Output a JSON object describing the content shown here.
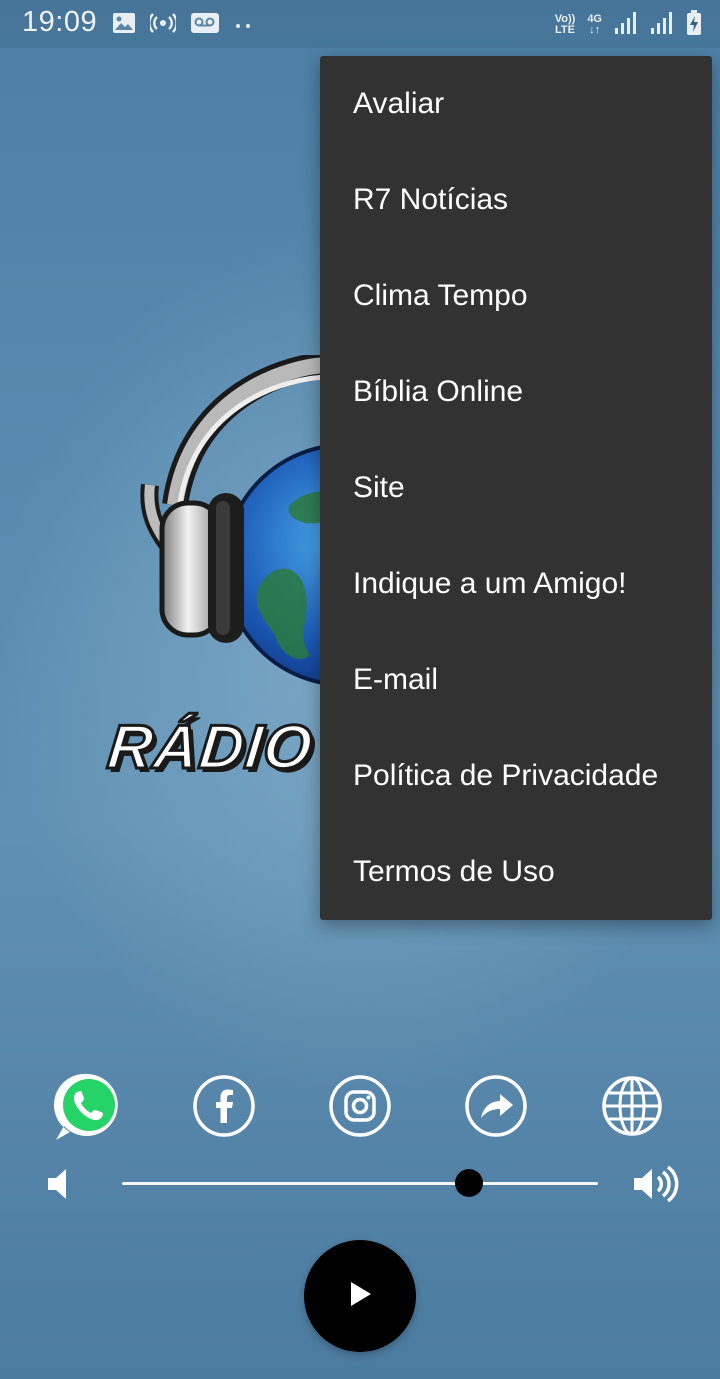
{
  "status_bar": {
    "time": "19:09",
    "volte_line1": "Vo))",
    "volte_line2": "LTE",
    "net_line1": "4G",
    "net_line2": "↓↑",
    "icons": [
      "image-icon",
      "hotspot-icon",
      "voicemail-icon",
      "dots-icon",
      "volte-icon",
      "signal-icon",
      "signal-icon",
      "battery-charging-icon"
    ]
  },
  "logo": {
    "text": "RÁDIO A"
  },
  "menu": {
    "items": [
      "Avaliar",
      "R7 Notícias",
      "Clima Tempo",
      "Bíblia Online",
      "Site",
      "Indique a um Amigo!",
      "E-mail",
      "Política de Privacidade",
      "Termos de Uso"
    ]
  },
  "social": {
    "icons": [
      "whatsapp-icon",
      "facebook-icon",
      "instagram-icon",
      "share-icon",
      "globe-icon"
    ]
  },
  "player": {
    "volume_fraction": 0.73,
    "play_icon": "play-icon"
  },
  "colors": {
    "menu_bg": "#323232",
    "whatsapp": "#25d366",
    "accent": "#000000"
  }
}
